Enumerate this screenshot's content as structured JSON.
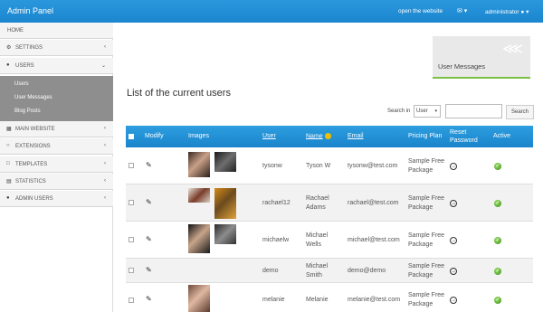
{
  "topbar": {
    "title": "Admin Panel",
    "open_site": "open the website",
    "mail_icon": "envelope-icon",
    "user": "administrator",
    "user_icon": "user-icon"
  },
  "sidebar": {
    "items": [
      {
        "label": "HOME",
        "icon": ""
      },
      {
        "label": "SETTINGS",
        "icon": "cogs-icon"
      },
      {
        "label": "USERS",
        "icon": "user-icon"
      },
      {
        "label": "MAIN WEBSITE",
        "icon": "columns-icon"
      },
      {
        "label": "EXTENSIONS",
        "icon": "circle-icon"
      },
      {
        "label": "TEMPLATES",
        "icon": "square-icon"
      },
      {
        "label": "STATISTICS",
        "icon": "chart-icon"
      },
      {
        "label": "ADMIN USERS",
        "icon": "users-icon"
      }
    ],
    "submenu": [
      "Users",
      "User Messages",
      "Blog Posts"
    ]
  },
  "messages_card": {
    "label": "User Messages",
    "icon": "share-icon"
  },
  "page_title": "List of the current users",
  "search": {
    "label": "Search in",
    "select_value": "User",
    "input_value": "",
    "button": "Search"
  },
  "table": {
    "headers": {
      "modify": "Modify",
      "images": "Images",
      "user": "User",
      "name": "Name",
      "email": "Email",
      "pricing": "Pricing Plan",
      "reset_1": "Reset",
      "reset_2": "Password",
      "active": "Active"
    },
    "rows": [
      {
        "user": "tysonw",
        "name_1": "Tyson W",
        "name_2": "",
        "email": "tysonw@test.com",
        "plan_1": "Sample Free",
        "plan_2": "Package"
      },
      {
        "user": "rachael12",
        "name_1": "Rachael",
        "name_2": "Adams",
        "email": "rachael@test.com",
        "plan_1": "Sample Free",
        "plan_2": "Package"
      },
      {
        "user": "michaelw",
        "name_1": "Michael",
        "name_2": "Wells",
        "email": "michael@test.com",
        "plan_1": "Sample Free",
        "plan_2": "Package"
      },
      {
        "user": "demo",
        "name_1": "Michael",
        "name_2": "Smith",
        "email": "demo@demo",
        "plan_1": "Sample Free",
        "plan_2": "Package"
      },
      {
        "user": "melanie",
        "name_1": "Melanie",
        "name_2": "",
        "email": "melanie@test.com",
        "plan_1": "Sample Free",
        "plan_2": "Package"
      }
    ]
  },
  "colors": {
    "topbar": "#1b86cf",
    "active_green": "#3c8d12",
    "card_accent": "#7cc242"
  }
}
